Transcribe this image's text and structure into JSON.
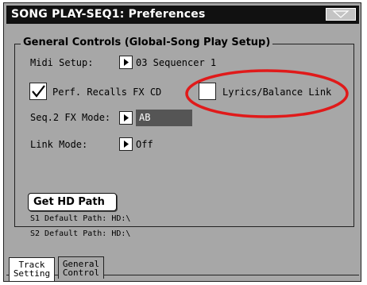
{
  "window": {
    "title": "SONG PLAY-SEQ1: Preferences",
    "menu_icon": "triangle-down-icon"
  },
  "group": {
    "legend": "General Controls (Global-Song Play Setup)"
  },
  "midi_setup": {
    "label": "Midi Setup:",
    "value": "03 Sequencer 1"
  },
  "perf_recalls": {
    "label": "Perf. Recalls FX CD",
    "checked": true
  },
  "lyrics_balance": {
    "label": "Lyrics/Balance Link",
    "checked": false
  },
  "seq2_fx_mode": {
    "label": "Seq.2 FX Mode:",
    "value": "AB"
  },
  "link_mode": {
    "label": "Link Mode:",
    "value": "Off"
  },
  "hd_path_button": {
    "label": "Get HD Path"
  },
  "paths": {
    "s1": "S1 Default Path: HD:\\",
    "s2": "S2 Default Path: HD:\\"
  },
  "tabs": [
    {
      "line1": "Track",
      "line2": "Setting",
      "active": true
    },
    {
      "line1": "General",
      "line2": "Control",
      "active": false
    }
  ],
  "colors": {
    "panel": "#a7a7a7",
    "titlebar": "#111111",
    "highlight_oval": "#e01a1a"
  }
}
